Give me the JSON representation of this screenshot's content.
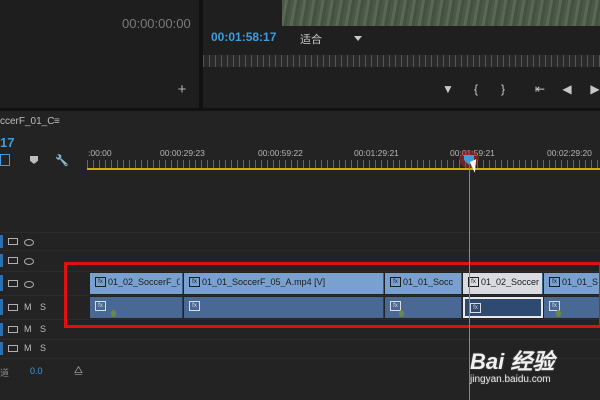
{
  "source_monitor": {
    "timecode": "00:00:00:00"
  },
  "program_monitor": {
    "timecode": "00:01:58:17",
    "zoom": "适合"
  },
  "sequence": {
    "tab_label": "ccerF_01_C",
    "menu_icon": "≡",
    "timecode": "17"
  },
  "ruler": {
    "ticks": [
      ":00:00",
      "00:00:29:23",
      "00:00:59:22",
      "00:01:29:21",
      "00:01:59:21",
      "00:02:29:20"
    ]
  },
  "tracks": {
    "video": [
      {
        "label": ""
      },
      {
        "label": ""
      },
      {
        "label": ""
      }
    ],
    "audio": [
      {
        "m": "M",
        "s": "S"
      },
      {
        "m": "M",
        "s": "S"
      },
      {
        "m": "M",
        "s": "S"
      }
    ]
  },
  "clips": {
    "video": [
      {
        "name": "01_02_SoccerF_0"
      },
      {
        "name": "01_01_SoccerF_05_A.mp4 [V]"
      },
      {
        "name": "01_01_Socc"
      },
      {
        "name": "01_02_Soccer"
      },
      {
        "name": "01_01_S"
      }
    ],
    "fx_label": "fx"
  },
  "master": {
    "label": "道",
    "value": "0.0"
  },
  "watermark": {
    "brand": "Bai 经验",
    "url": "jingyan.baidu.com"
  },
  "colors": {
    "accent": "#3d9de0",
    "highlight_box": "#e01010",
    "video_clip": "#7aa0cf",
    "audio_clip": "#4a6894"
  }
}
